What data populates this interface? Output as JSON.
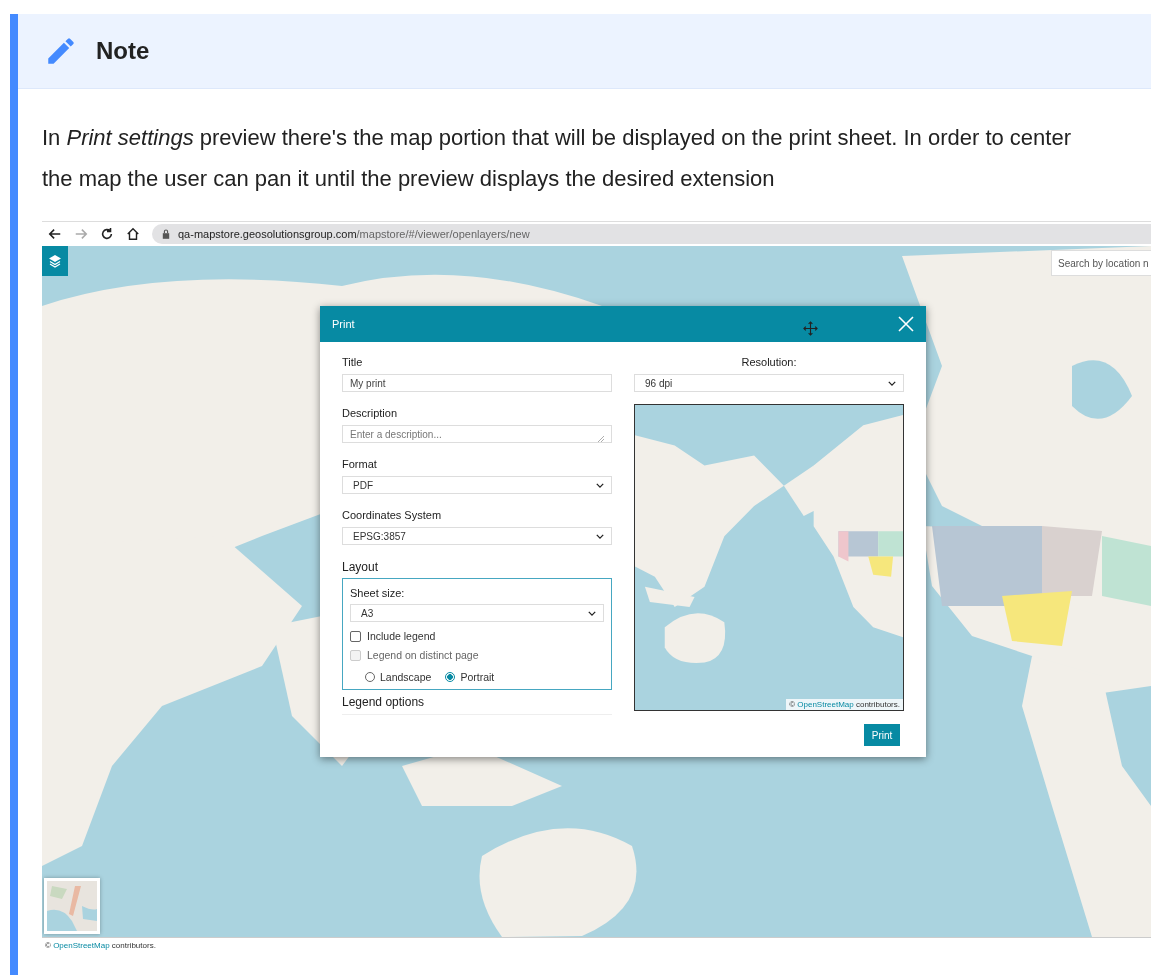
{
  "note": {
    "title": "Note",
    "text": "In *Print settings* preview there's the map portion that will be displayed on the print sheet. In order to center the map the user can pan it until the preview displays the desired extension"
  },
  "browser": {
    "nav": [
      {
        "kind": "back",
        "disabled": false
      },
      {
        "kind": "forward",
        "disabled": true
      },
      {
        "kind": "reload",
        "disabled": false
      },
      {
        "kind": "home",
        "disabled": false
      }
    ],
    "url_host": "qa-mapstore.geosolutionsgroup.com",
    "url_path": "/mapstore/#/viewer/openlayers/new"
  },
  "map": {
    "search": {
      "placeholder": "Search by location n"
    },
    "attribution": {
      "prefix": "©",
      "link": "OpenStreetMap",
      "suffix": "contributors."
    }
  },
  "print_dialog": {
    "title": "Print",
    "fields": [
      {
        "kind": "text",
        "label": "Title",
        "value": "My print"
      },
      {
        "kind": "textarea",
        "label": "Description",
        "placeholder": "Enter a description..."
      },
      {
        "kind": "select",
        "label": "Format",
        "value": "PDF"
      },
      {
        "kind": "select",
        "label": "Coordinates System",
        "value": "EPSG:3857"
      }
    ],
    "layout": {
      "title": "Layout",
      "sheet_size_label": "Sheet size:",
      "sheet_size": "A3",
      "checkboxes": [
        {
          "label": "Include legend",
          "checked": false,
          "disabled": false
        },
        {
          "label": "Legend on distinct page",
          "checked": false,
          "disabled": true
        }
      ],
      "orientations": [
        {
          "label": "Landscape",
          "selected": false
        },
        {
          "label": "Portrait",
          "selected": true
        }
      ]
    },
    "legend_options": "Legend options",
    "resolution_label": "Resolution:",
    "resolution": "96 dpi",
    "preview_attribution": {
      "prefix": "©",
      "link": "OpenStreetMap",
      "suffix": "contributors."
    },
    "print_button": "Print"
  }
}
